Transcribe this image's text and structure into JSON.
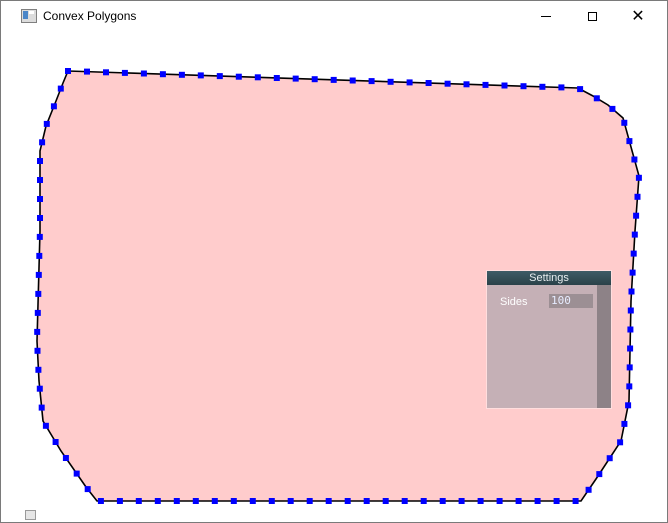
{
  "window": {
    "title": "Convex Polygons",
    "icon": "app-window-icon",
    "controls": {
      "minimize": "minimize-icon",
      "maximize": "maximize-icon",
      "close": "close-icon",
      "close_glyph": "✕"
    }
  },
  "canvas": {
    "polygon_fill": "#ffcccc",
    "polygon_stroke": "#000000",
    "vertex_color": "#0000ff",
    "vertex_count": 100
  },
  "settings": {
    "title": "Settings",
    "sides_label": "Sides",
    "sides_value": "100"
  },
  "status": {
    "corner_icon": "resize-grip-icon"
  }
}
